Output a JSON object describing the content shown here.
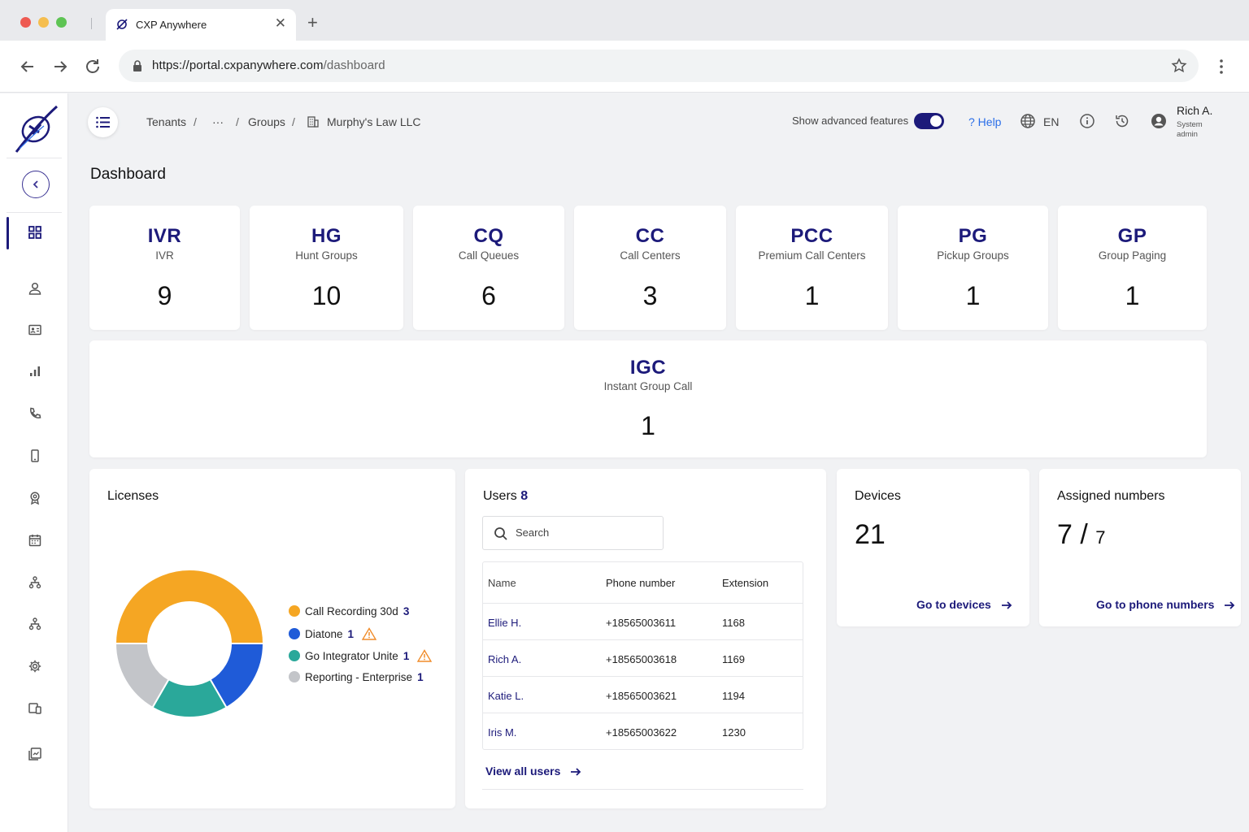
{
  "browser": {
    "tab_title": "CXP Anywhere",
    "tab_close": "✕",
    "new_tab": "+",
    "url_host": "https://portal.cxpanywhere.com",
    "url_path": "/dashboard"
  },
  "header": {
    "breadcrumbs": [
      "Tenants",
      "···",
      "Groups",
      "Murphy's Law LLC"
    ],
    "breadcrumb_separator": "/",
    "advanced_label": "Show advanced features",
    "advanced_enabled": true,
    "help_label": "? Help",
    "language": "EN",
    "user_name": "Rich A.",
    "user_role": "System admin"
  },
  "page_title": "Dashboard",
  "stats": [
    {
      "abbr": "IVR",
      "name": "IVR",
      "value": "9"
    },
    {
      "abbr": "HG",
      "name": "Hunt Groups",
      "value": "10"
    },
    {
      "abbr": "CQ",
      "name": "Call Queues",
      "value": "6"
    },
    {
      "abbr": "CC",
      "name": "Call Centers",
      "value": "3"
    },
    {
      "abbr": "PCC",
      "name": "Premium Call Centers",
      "value": "1"
    },
    {
      "abbr": "PG",
      "name": "Pickup Groups",
      "value": "1"
    },
    {
      "abbr": "GP",
      "name": "Group Paging",
      "value": "1"
    },
    {
      "abbr": "IGC",
      "name": "Instant Group Call",
      "value": "1"
    }
  ],
  "licenses": {
    "title": "Licenses",
    "items": [
      {
        "name": "Call Recording 30d",
        "count": "3",
        "color": "#f5a623",
        "warning": false
      },
      {
        "name": "Diatone",
        "count": "1",
        "color": "#1f5bd8",
        "warning": true
      },
      {
        "name": "Go Integrator Unite",
        "count": "1",
        "color": "#2aa89a",
        "warning": true
      },
      {
        "name": "Reporting - Enterprise",
        "count": "1",
        "color": "#c3c5c9",
        "warning": false
      }
    ]
  },
  "users": {
    "title": "Users",
    "count": "8",
    "search_placeholder": "Search",
    "columns": [
      "Name",
      "Phone number",
      "Extension"
    ],
    "rows": [
      {
        "name": "Ellie H.",
        "phone": "+18565003611",
        "ext": "1168"
      },
      {
        "name": "Rich A.",
        "phone": "+18565003618",
        "ext": "1169"
      },
      {
        "name": "Katie L.",
        "phone": "+18565003621",
        "ext": "1194"
      },
      {
        "name": "Iris M.",
        "phone": "+18565003622",
        "ext": "1230"
      }
    ],
    "view_all": "View all users"
  },
  "devices": {
    "title": "Devices",
    "count": "21",
    "link": "Go to devices"
  },
  "numbers": {
    "title": "Assigned numbers",
    "assigned": "7",
    "separator": " / ",
    "total": "7",
    "link": "Go to phone numbers"
  },
  "colors": {
    "brand": "#1c1a7a",
    "accent_blue": "#2a6ee8",
    "warning": "#f08c2a"
  },
  "icons": {
    "sidebar": [
      "dashboard-icon",
      "user-icon",
      "contact-card-icon",
      "bar-chart-icon",
      "phone-icon",
      "mobile-device-icon",
      "award-icon",
      "calendar-icon",
      "hierarchy-icon",
      "hierarchy-icon",
      "settings-icon",
      "devices-icon",
      "reports-icon"
    ]
  }
}
